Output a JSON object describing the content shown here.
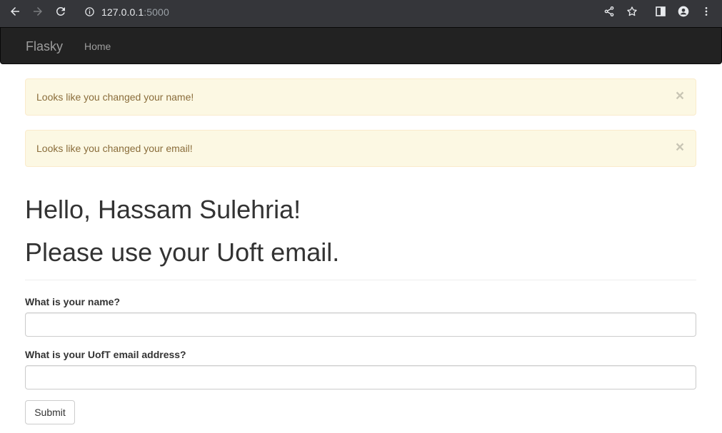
{
  "browser": {
    "url_host": "127.0.0.1",
    "url_port": ":5000",
    "icons": [
      "back-arrow-icon",
      "forward-arrow-icon",
      "reload-icon",
      "info-icon",
      "share-icon",
      "star-icon",
      "side-panel-icon",
      "profile-icon",
      "more-vert-icon"
    ]
  },
  "navbar": {
    "brand": "Flasky",
    "links": [
      {
        "label": "Home"
      }
    ]
  },
  "alerts": [
    {
      "text": "Looks like you changed your name!",
      "close": "×"
    },
    {
      "text": "Looks like you changed your email!",
      "close": "×"
    }
  ],
  "header": {
    "greeting": "Hello, Hassam Sulehria!",
    "message": "Please use your Uoft email."
  },
  "form": {
    "name_label": "What is your name?",
    "name_value": "",
    "email_label": "What is your UofT email address?",
    "email_value": "",
    "submit_label": "Submit"
  },
  "colors": {
    "chrome_bg": "#35363a",
    "navbar_bg": "#222222",
    "alert_bg": "#fcf8e3",
    "alert_border": "#faebcc",
    "alert_text": "#8a6d3b"
  }
}
